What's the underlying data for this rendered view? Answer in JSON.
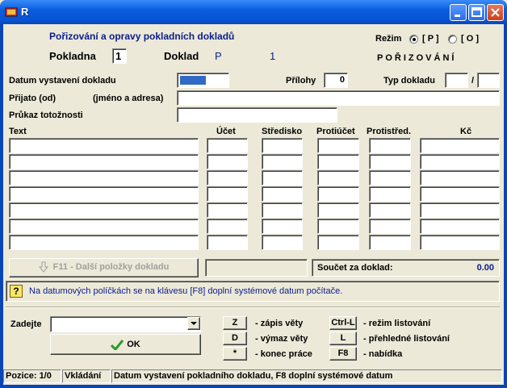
{
  "window": {
    "title": "R"
  },
  "header": {
    "title": "Pořizování a opravy pokladních dokladů",
    "pokladna_label": "Pokladna",
    "pokladna_value": "1",
    "doklad_label": "Doklad",
    "doklad_type": "P",
    "doklad_number": "1",
    "rezim_label": "Režim",
    "rezim_options": [
      "[ P ]",
      "[ O ]"
    ],
    "rezim_selected": "[ P ]",
    "mode_text": "POŘIZOVÁNÍ"
  },
  "form": {
    "datum_label": "Datum vystavení dokladu",
    "prilohy_label": "Přílohy",
    "prilohy_value": "0",
    "typ_label": "Typ dokladu",
    "typ_separator": "/",
    "prijato_label": "Přijato (od)",
    "jmeno_label": "(jméno a adresa)",
    "prukaz_label": "Průkaz totožnosti"
  },
  "table": {
    "columns": [
      "Text",
      "Účet",
      "Středisko",
      "Protiúčet",
      "Protistřed.",
      "Kč"
    ],
    "row_count": 7
  },
  "more_items_button": "F11 - Další položky dokladu",
  "sum": {
    "label": "Součet za doklad:",
    "value": "0.00"
  },
  "hint": "Na datumových políčkách se na klávesu [F8] doplní systémové datum počítače.",
  "command": {
    "label": "Zadejte",
    "ok_label": "OK",
    "shortcuts": [
      {
        "key": "Z",
        "desc": "- zápis věty"
      },
      {
        "key": "D",
        "desc": "- výmaz věty"
      },
      {
        "key": "*",
        "desc": "- konec práce"
      },
      {
        "key": "Ctrl-L",
        "desc": "- režim listování"
      },
      {
        "key": "L",
        "desc": "- přehledné listování"
      },
      {
        "key": "F8",
        "desc": "- nabídka"
      }
    ]
  },
  "status": {
    "position": "Pozice: 1/0",
    "mode": "Vkládání",
    "message": "Datum vystavení pokladního dokladu, F8 doplní systémové datum"
  },
  "colors": {
    "accent": "#0a1d8c",
    "titlebar": "#0853d0",
    "date_fill": "#316ac5"
  }
}
